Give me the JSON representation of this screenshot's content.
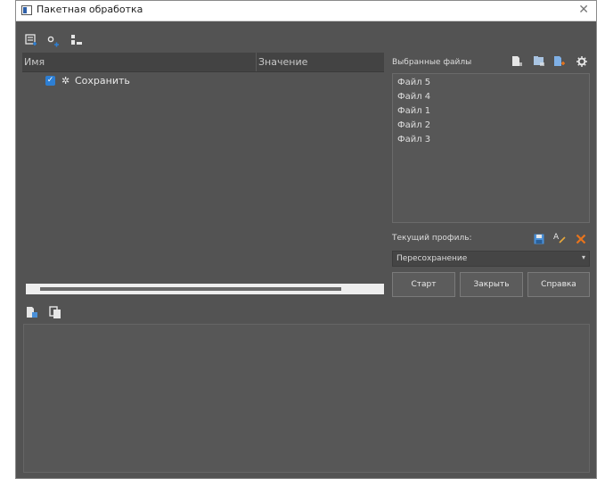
{
  "window": {
    "title": "Пакетная обработка"
  },
  "toolbar": {
    "icons": [
      "add-list-icon",
      "add-gear-icon",
      "remove-item-icon"
    ]
  },
  "tree": {
    "columns": {
      "name": "Имя",
      "value": "Значение"
    },
    "rows": [
      {
        "label": "Сохранить",
        "checked": true
      }
    ]
  },
  "files": {
    "header": "Выбранные файлы",
    "items": [
      "Файл 5",
      "Файл 4",
      "Файл 1",
      "Файл 2",
      "Файл 3"
    ]
  },
  "profile": {
    "label": "Текущий профиль:",
    "selected": "Пересохранение"
  },
  "buttons": {
    "start": "Старт",
    "close": "Закрыть",
    "help": "Справка"
  },
  "colors": {
    "accent_blue": "#2d7fd4",
    "delete_orange": "#e8741c",
    "background": "#535353"
  }
}
